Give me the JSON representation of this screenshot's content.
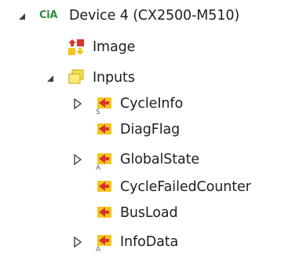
{
  "tree": {
    "device": {
      "logo_text": "CiA",
      "label": "Device 4 (CX2500-M510)",
      "expanded": true
    },
    "image": {
      "label": "Image"
    },
    "inputs": {
      "label": "Inputs",
      "expanded": true,
      "children": [
        {
          "label": "CycleInfo",
          "collapsed": true,
          "overlay": "S"
        },
        {
          "label": "DiagFlag"
        },
        {
          "label": "GlobalState",
          "collapsed": true,
          "overlay": "A"
        },
        {
          "label": "CycleFailedCounter"
        },
        {
          "label": "BusLoad"
        },
        {
          "label": "InfoData",
          "collapsed": true,
          "overlay": "A"
        }
      ]
    }
  },
  "colors": {
    "input_var_yellow": "#f4c51c",
    "input_var_red": "#d9342b",
    "folder_yellow": "#f5e15a",
    "cia_green": "#2e8b3c"
  }
}
